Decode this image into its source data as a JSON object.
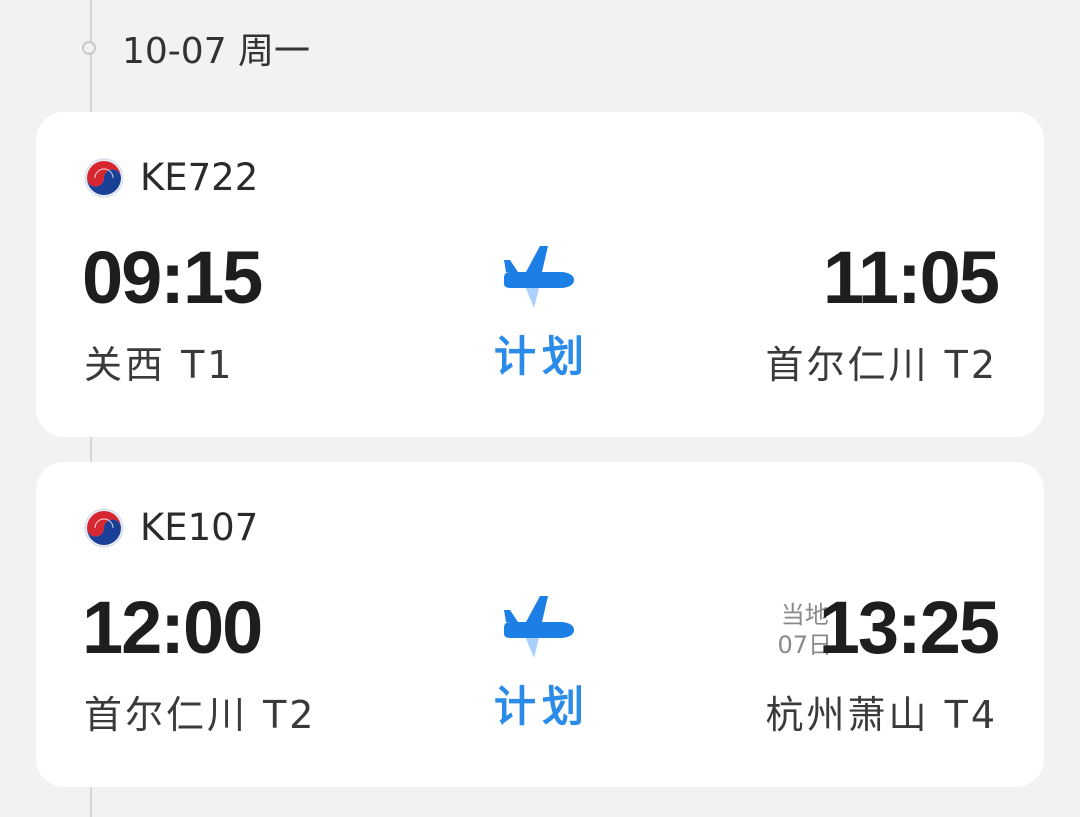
{
  "header": {
    "date_label": "10-07 周一"
  },
  "colors": {
    "background": "#f2f2f2",
    "card": "#ffffff",
    "status_blue": "#2a8be8",
    "plane_blue": "#1c7fe6",
    "plane_light_blue": "#a9d1fb"
  },
  "flights": [
    {
      "airline_icon": "korean-air-logo",
      "flight_no": "KE722",
      "depart_time": "09:15",
      "depart_airport": "关西 T1",
      "arrive_time": "11:05",
      "arrive_airport": "首尔仁川 T2",
      "status": "计划",
      "status_icon": "airplane-icon"
    },
    {
      "airline_icon": "korean-air-logo",
      "flight_no": "KE107",
      "depart_time": "12:00",
      "depart_airport": "首尔仁川 T2",
      "arrive_time": "13:25",
      "arrive_airport": "杭州萧山 T4",
      "status": "计划",
      "status_icon": "airplane-icon",
      "local_note_line1": "当地",
      "local_note_line2": "07日"
    }
  ]
}
